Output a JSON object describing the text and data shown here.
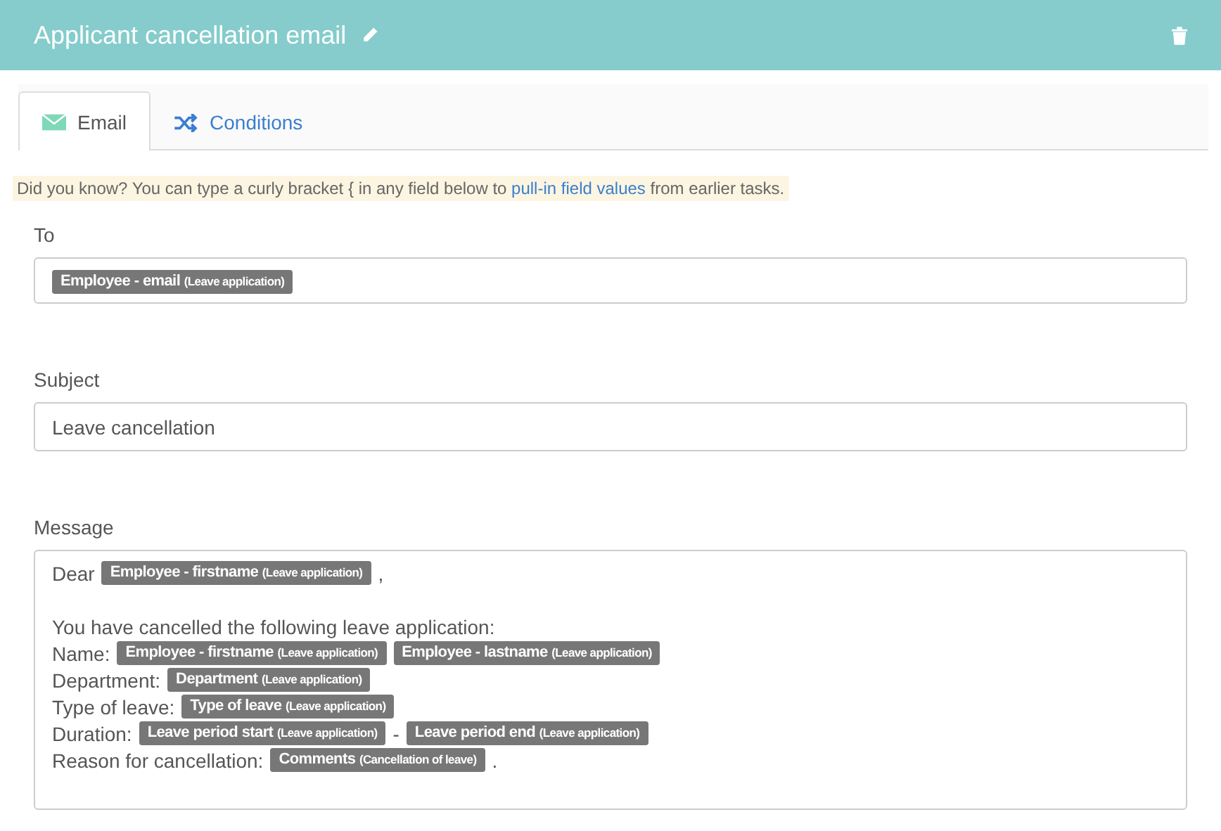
{
  "header": {
    "title": "Applicant cancellation email"
  },
  "tabs": [
    {
      "label": "Email",
      "kind": "email",
      "selected": true
    },
    {
      "label": "Conditions",
      "kind": "conditions",
      "selected": false
    }
  ],
  "tip": {
    "before": "Did you know? You can type a curly bracket { in any field below to ",
    "link": "pull-in field values",
    "after": " from earlier tasks."
  },
  "to": {
    "label": "To",
    "tokens": [
      {
        "field": "Employee - email",
        "source": "(Leave application)"
      }
    ]
  },
  "subject": {
    "label": "Subject",
    "value": "Leave cancellation"
  },
  "message": {
    "label": "Message",
    "lines": [
      {
        "kind": "content",
        "segments": [
          {
            "kind": "text",
            "text": "Dear"
          },
          {
            "kind": "token",
            "field": "Employee - firstname",
            "source": "(Leave application)"
          },
          {
            "kind": "text",
            "text": ","
          }
        ]
      },
      {
        "kind": "blank"
      },
      {
        "kind": "content",
        "segments": [
          {
            "kind": "text",
            "text": "You have cancelled the following leave application:"
          }
        ]
      },
      {
        "kind": "content",
        "segments": [
          {
            "kind": "text",
            "text": "Name:"
          },
          {
            "kind": "token",
            "field": "Employee - firstname",
            "source": "(Leave application)"
          },
          {
            "kind": "token",
            "field": "Employee - lastname",
            "source": "(Leave application)"
          }
        ]
      },
      {
        "kind": "content",
        "segments": [
          {
            "kind": "text",
            "text": "Department:"
          },
          {
            "kind": "token",
            "field": "Department",
            "source": "(Leave application)"
          }
        ]
      },
      {
        "kind": "content",
        "segments": [
          {
            "kind": "text",
            "text": "Type of leave:"
          },
          {
            "kind": "token",
            "field": "Type of leave",
            "source": "(Leave application)"
          }
        ]
      },
      {
        "kind": "content",
        "segments": [
          {
            "kind": "text",
            "text": "Duration:"
          },
          {
            "kind": "token",
            "field": "Leave period start",
            "source": "(Leave application)"
          },
          {
            "kind": "text",
            "text": "-"
          },
          {
            "kind": "token",
            "field": "Leave period end",
            "source": "(Leave application)"
          }
        ]
      },
      {
        "kind": "content",
        "segments": [
          {
            "kind": "text",
            "text": "Reason for cancellation:"
          },
          {
            "kind": "token",
            "field": "Comments",
            "source": "(Cancellation of leave)"
          },
          {
            "kind": "text",
            "text": "."
          }
        ]
      }
    ]
  }
}
